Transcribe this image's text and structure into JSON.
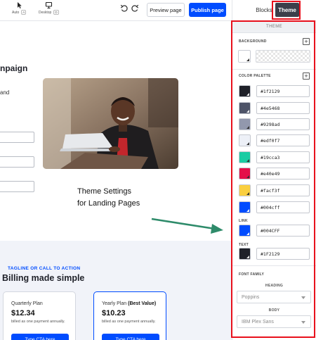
{
  "toolbar": {
    "auto_label": "Auto",
    "auto_key": "A",
    "desktop_label": "Desktop",
    "desktop_key": "D",
    "preview_label": "Preview page",
    "publish_label": "Publish page",
    "icons": [
      "cursor-icon",
      "monitor-icon",
      "undo-icon",
      "redo-icon"
    ]
  },
  "canvas": {
    "hero_title": "npaign",
    "hero_text": "and",
    "annotation_line1": "Theme Settings",
    "annotation_line2": "for Landing Pages",
    "pricing": {
      "tagline": "TAGLINE OR CALL TO ACTION",
      "title": "Billing made simple",
      "plans": [
        {
          "name": "Quarterly Plan",
          "badge": "",
          "price": "$12.34",
          "note": "billed as one payment annually.",
          "cta": "Type CTA here"
        },
        {
          "name": "Yearly Plan ",
          "badge": "(Best Value)",
          "price": "$10.23",
          "note": "billed as one payment annually.",
          "cta": "Type CTA here"
        }
      ]
    }
  },
  "panel": {
    "tabs": {
      "blocks": "Blocks",
      "theme": "Theme"
    },
    "header": "THEME",
    "background_label": "BACKGROUND",
    "palette_label": "COLOR PALETTE",
    "palette": [
      {
        "hex": "#1f2129",
        "label": "#1f2129"
      },
      {
        "hex": "#4e5468",
        "label": "#4e5468"
      },
      {
        "hex": "#9298ad",
        "label": "#9298ad"
      },
      {
        "hex": "#edf0f7",
        "label": "#edf0f7"
      },
      {
        "hex": "#19cca3",
        "label": "#19cca3"
      },
      {
        "hex": "#e40e49",
        "label": "#e40e49"
      },
      {
        "hex": "#facf3f",
        "label": "#facf3f"
      },
      {
        "hex": "#004cff",
        "label": "#004cff"
      }
    ],
    "link_label": "LINK",
    "link_color": {
      "hex": "#004CFF",
      "label": "#004CFF"
    },
    "text_label": "TEXT",
    "text_color": {
      "hex": "#1F2129",
      "label": "#1F2129"
    },
    "font_family_label": "FONT FAMILY",
    "heading_label": "HEADING",
    "heading_font": "Poppins",
    "body_label": "BODY",
    "body_font": "IBM Plex Sans"
  },
  "colors": {
    "accent": "#004cff",
    "highlight_border": "#e8101c",
    "annotation_arrow": "#2e8b6a",
    "active_tab": "#3c3f4a"
  }
}
